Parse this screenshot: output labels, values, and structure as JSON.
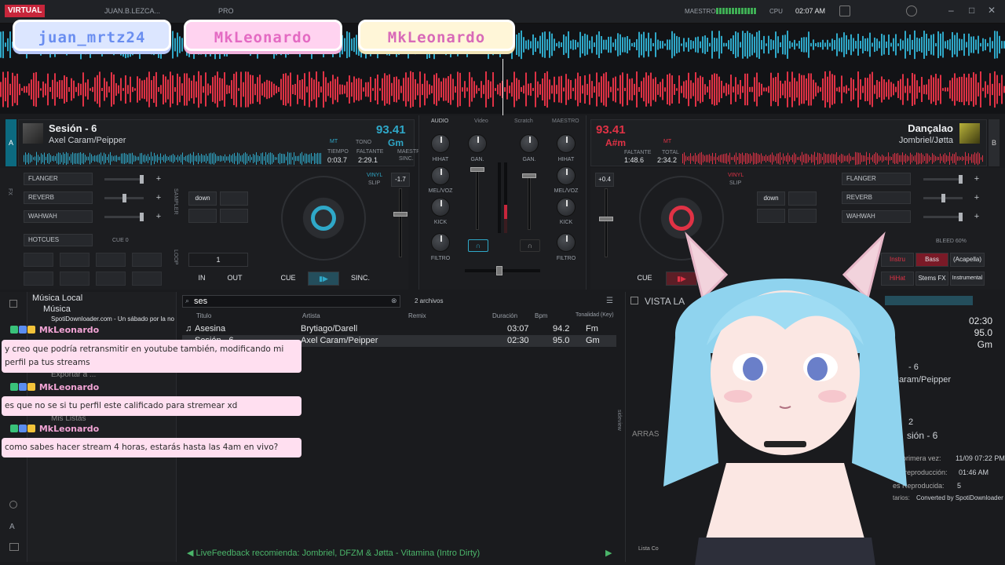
{
  "topbar": {
    "logo": "VIRTUAL",
    "user": "JUAN.B.LEZCA...",
    "plan": "PRO",
    "master_label": "MAESTRO",
    "cpu_label": "CPU",
    "time": "02:07 AM"
  },
  "overlay": {
    "names": [
      "juan_mrtz24",
      "MkLeonardo",
      "MkLeonardo"
    ]
  },
  "deck_a": {
    "letter": "A",
    "title": "Sesión - 6",
    "artist": "Axel Caram/Peipper",
    "bpm": "93.41",
    "key": "Gm",
    "key_mode": "MT",
    "tono_label": "TONO",
    "tiempo_label": "TIEMPO",
    "faltante_label": "FALTANTE",
    "maestro_label": "MAESTRO",
    "sinc_label": "SINC.",
    "elapsed": "0:03.7",
    "remaining": "2:29.1",
    "pitch": "-1.7",
    "fx": [
      "FLANGER",
      "REVERB",
      "WAHWAH"
    ],
    "pads_mode": "HOTCUES",
    "cue_label": "CUE 0",
    "loop_value": "1",
    "down_label": "down",
    "buttons": {
      "in": "IN",
      "out": "OUT",
      "cue": "CUE",
      "sync": "SINC."
    },
    "vinyl": "VINYL",
    "slip": "SLIP"
  },
  "deck_b": {
    "letter": "B",
    "title": "Dançalao",
    "artist": "Jombriel/Jøtta",
    "bpm": "93.41",
    "key": "A#m",
    "key_mode": "MT",
    "faltante_label": "FALTANTE",
    "total_label": "TOTAL",
    "elapsed": "1:48.6",
    "total": "2:34.2",
    "pitch": "+0.4",
    "fx": [
      "FLANGER",
      "REVERB",
      "WAHWAH"
    ],
    "down_label": "down",
    "cue": "CUE",
    "stems_label": "BLEED 60%",
    "stems": [
      "Instru",
      "Bass",
      "(Acapella)",
      "HiHat",
      "Stems FX",
      "Instrumental"
    ],
    "vinyl": "VINYL",
    "slip": "SLIP"
  },
  "mixer": {
    "tabs": [
      "AUDIO",
      "Video",
      "Scratch",
      "MAESTRO"
    ],
    "left_knobs": [
      "HIHAT",
      "MEL/VOZ",
      "KICK",
      "FILTRO"
    ],
    "right_knobs": [
      "HIHAT",
      "MEL/VOZ",
      "KICK",
      "FILTRO"
    ],
    "gain_left": "GAN.",
    "gain_right": "GAN."
  },
  "browser": {
    "tree": [
      "Música Local",
      "Música",
      "SpotiDownloader.com - Un sábado por la no",
      "Exportar a ...",
      "Mis Listas"
    ],
    "search": "ses",
    "count": "2 archivos",
    "columns": [
      "Titulo",
      "Artista",
      "Remix",
      "Duración",
      "Bpm",
      "Tonalidad (Key)"
    ],
    "rows": [
      {
        "title": "Asesina",
        "artist": "Brytiago/Darell",
        "duration": "03:07",
        "bpm": "94.2",
        "key": "Fm"
      },
      {
        "title": "Sesión - 6",
        "artist": "Axel Caram/Peipper",
        "duration": "02:30",
        "bpm": "95.0",
        "key": "Gm"
      }
    ],
    "recommendation": "LiveFeedback recomienda: Jombriel, DFZM & Jøtta - Vitamina (Intro Dirty)"
  },
  "sidepanel": {
    "header": "VISTA LA",
    "duration": "02:30",
    "bpm": "95.0",
    "key": "Gm",
    "title": "- 6",
    "artist": "Caram/Peipper",
    "num": "2",
    "session": "sión - 6",
    "drag_label": "ARRAS",
    "first_label": "primera vez:",
    "first_value": "11/09 07:22 PM",
    "last_label": "ma reproducción:",
    "last_value": "01:46 AM",
    "plays_label": "es Reproducida:",
    "plays_value": "5",
    "comment_label": "tarios:",
    "comment_value": "Converted by SpotiDownloader",
    "footer": "Lista Co",
    "side_tab": "sideview"
  },
  "chat": [
    {
      "user": "MkLeonardo",
      "message": "y creo que podría retransmitir en youtube también, modificando mi perfil pa tus streams"
    },
    {
      "user": "MkLeonardo",
      "message": "es que no se si tu perfil este calificado para stremear xd"
    },
    {
      "user": "MkLeonardo",
      "message": "como sabes hacer stream 4 horas, estarás hasta las 4am en vivo?"
    }
  ],
  "colors": {
    "deck_a": "#2fa8c8",
    "deck_b": "#e03245",
    "chat_bubble": "#ffdff0",
    "reco": "#4bb56a"
  }
}
